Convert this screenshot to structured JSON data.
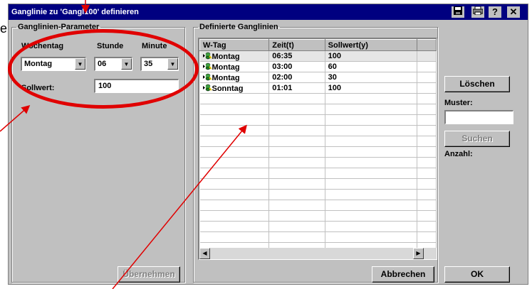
{
  "window": {
    "title": "Ganglinie zu 'Gangl100' definieren"
  },
  "titlebar_icons": [
    "save-icon",
    "print-icon",
    "help-icon",
    "close-icon"
  ],
  "left_panel": {
    "legend": "Ganglinien-Parameter",
    "wochentag_label": "Wochentag",
    "stunde_label": "Stunde",
    "minute_label": "Minute",
    "wochentag_value": "Montag",
    "stunde_value": "06",
    "minute_value": "35",
    "sollwert_label": "Sollwert:",
    "sollwert_value": "100",
    "uebernehmen_label": "Übernehmen"
  },
  "right_panel": {
    "legend": "Definierte Ganglinien",
    "columns": [
      "W-Tag",
      "Zeit(t)",
      "Sollwert(y)"
    ],
    "rows": [
      {
        "day": "Montag",
        "time": "06:35",
        "value": "100"
      },
      {
        "day": "Montag",
        "time": "03:00",
        "value": "60"
      },
      {
        "day": "Montag",
        "time": "02:00",
        "value": "30"
      },
      {
        "day": "Sonntag",
        "time": "01:01",
        "value": "100"
      }
    ],
    "loeschen_label": "Löschen",
    "muster_label": "Muster:",
    "muster_value": "",
    "suchen_label": "Suchen",
    "anzahl_label": "Anzahl:"
  },
  "footer": {
    "abbrechen_label": "Abbrechen",
    "ok_label": "OK"
  },
  "colors": {
    "titlebar": "#000080",
    "dialog": "#c0c0c0",
    "annotation": "#e00000"
  },
  "annotation_letter": "e"
}
